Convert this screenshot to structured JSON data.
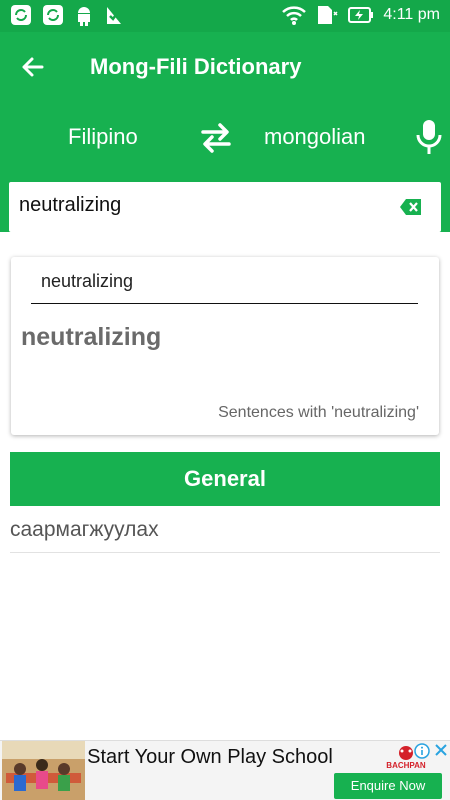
{
  "status_bar": {
    "time": "4:11 pm",
    "left_icons": [
      "sync-icon",
      "sync-icon",
      "android-icon",
      "check-flag-icon"
    ],
    "right_icons": [
      "wifi-icon",
      "sd-card-icon",
      "battery-charging-icon"
    ]
  },
  "app_bar": {
    "title": "Mong-Fili Dictionary",
    "back_icon": "arrow-left-icon"
  },
  "language_bar": {
    "from_language": "Filipino",
    "to_language": "mongolian",
    "swap_icon": "swap-arrows-icon",
    "mic_icon": "microphone-icon"
  },
  "search": {
    "value": "neutralizing",
    "clear_icon": "backspace-clear-icon"
  },
  "result_card": {
    "input_text": "neutralizing",
    "word": "neutralizing",
    "sentences_link": "Sentences with 'neutralizing'"
  },
  "general": {
    "label": "General"
  },
  "translation": {
    "text": "саармагжуулах"
  },
  "ad": {
    "headline": "Start Your Own Play School",
    "cta_label": "Enquire Now",
    "logo_text": "BACHPAN"
  },
  "colors": {
    "primary_green": "#17b150",
    "status_green": "#14a84a",
    "ad_logo_red": "#d4212a"
  }
}
